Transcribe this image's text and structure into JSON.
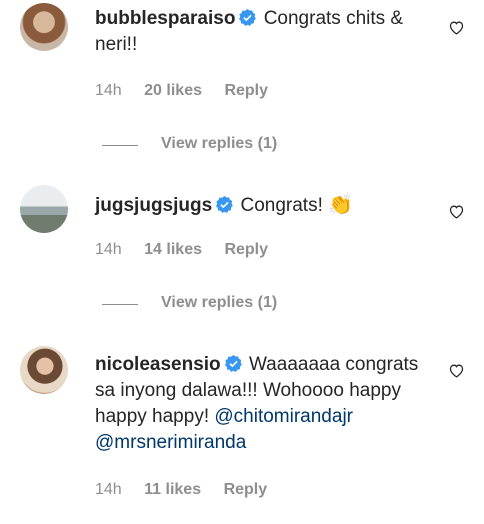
{
  "comments": [
    {
      "username": "bubblesparaiso",
      "text": "Congrats chits & neri!!",
      "time": "14h",
      "likes": "20 likes",
      "reply": "Reply",
      "view_replies": "View replies (1)"
    },
    {
      "username": "jugsjugsjugs",
      "text": "Congrats!",
      "emoji": "👏",
      "time": "14h",
      "likes": "14 likes",
      "reply": "Reply",
      "view_replies": "View replies (1)"
    },
    {
      "username": "nicoleasensio",
      "text": "Waaaaaaa congrats sa inyong dalawa!!! Wohoooo happy happy happy!",
      "mentions": [
        "@chitomirandajr",
        "@mrsnerimiranda"
      ],
      "time": "14h",
      "likes": "11 likes",
      "reply": "Reply"
    }
  ],
  "colors": {
    "verified": "#3897f0",
    "mention": "#00376b",
    "meta": "#8e8e8e"
  },
  "icons": {
    "verified": "verified-badge-icon",
    "like": "heart-outline-icon",
    "clap": "clapping-hands-emoji"
  }
}
